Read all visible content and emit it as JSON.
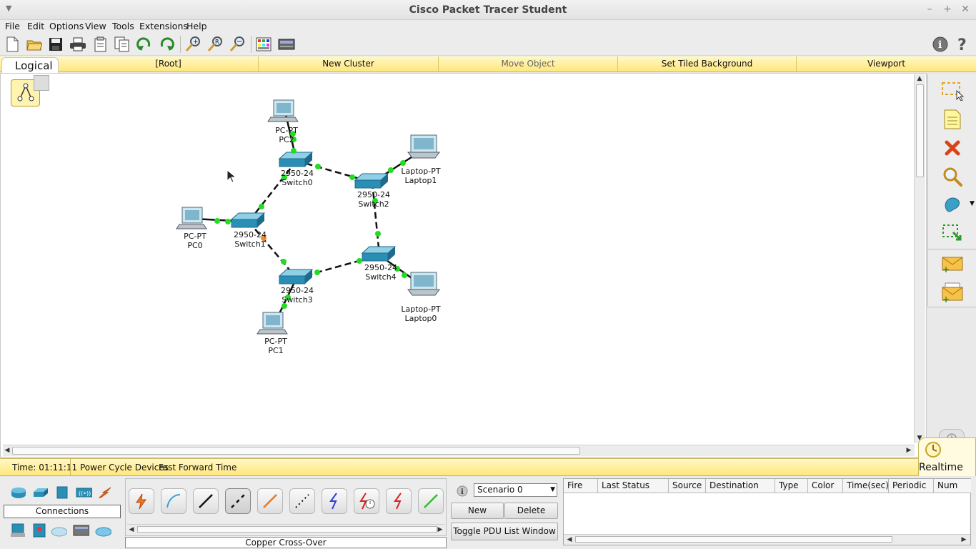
{
  "window": {
    "title": "Cisco Packet Tracer Student"
  },
  "menu": [
    "File",
    "Edit",
    "Options",
    "View",
    "Tools",
    "Extensions",
    "Help"
  ],
  "toolbar": {
    "icons": [
      "new-file-icon",
      "open-folder-icon",
      "save-icon",
      "print-icon",
      "activity-wizard-icon",
      "copy-icon",
      "undo-icon",
      "redo-icon",
      "zoom-in-icon",
      "zoom-reset-icon",
      "zoom-out-icon",
      "palette-icon",
      "custom-device-icon",
      "info-icon",
      "help-icon"
    ]
  },
  "logical_bar": {
    "tab": "Logical",
    "root": "[Root]",
    "new_cluster": "New Cluster",
    "move_object": "Move Object",
    "set_tiled_background": "Set Tiled Background",
    "viewport": "Viewport"
  },
  "topology": {
    "devices": [
      {
        "id": "pc2",
        "type": "PC-PT",
        "name": "PC2",
        "kind": "pc"
      },
      {
        "id": "switch0",
        "type": "2950-24",
        "name": "Switch0",
        "kind": "switch"
      },
      {
        "id": "switch2",
        "type": "2950-24",
        "name": "Switch2",
        "kind": "switch"
      },
      {
        "id": "laptop1",
        "type": "Laptop-PT",
        "name": "Laptop1",
        "kind": "laptop"
      },
      {
        "id": "pc0",
        "type": "PC-PT",
        "name": "PC0",
        "kind": "pc"
      },
      {
        "id": "switch1",
        "type": "2950-24",
        "name": "Switch1",
        "kind": "switch"
      },
      {
        "id": "switch4",
        "type": "2950-24",
        "name": "Switch4",
        "kind": "switch"
      },
      {
        "id": "switch3",
        "type": "2950-24",
        "name": "Switch3",
        "kind": "switch"
      },
      {
        "id": "laptop0",
        "type": "Laptop-PT",
        "name": "Laptop0",
        "kind": "laptop"
      },
      {
        "id": "pc1",
        "type": "PC-PT",
        "name": "PC1",
        "kind": "pc"
      }
    ],
    "links": [
      {
        "from": "pc2",
        "to": "switch0",
        "style": "solid",
        "status": "up"
      },
      {
        "from": "switch0",
        "to": "switch2",
        "style": "dashed",
        "status": "up"
      },
      {
        "from": "laptop1",
        "to": "switch2",
        "style": "solid",
        "status": "up"
      },
      {
        "from": "switch0",
        "to": "switch1",
        "style": "dashed",
        "status": "up"
      },
      {
        "from": "pc0",
        "to": "switch1",
        "style": "solid",
        "status": "up"
      },
      {
        "from": "switch2",
        "to": "switch4",
        "style": "dashed",
        "status": "up"
      },
      {
        "from": "switch1",
        "to": "switch3",
        "style": "dashed",
        "status": "orange-green"
      },
      {
        "from": "switch3",
        "to": "switch4",
        "style": "dashed",
        "status": "up"
      },
      {
        "from": "switch4",
        "to": "laptop0",
        "style": "solid",
        "status": "up"
      },
      {
        "from": "switch3",
        "to": "pc1",
        "style": "solid",
        "status": "up"
      }
    ]
  },
  "right_palette": [
    "select-icon",
    "note-icon",
    "delete-icon",
    "inspect-icon",
    "draw-shape-icon",
    "resize-icon",
    "add-simple-pdu-icon",
    "add-complex-pdu-icon"
  ],
  "timebar": {
    "time": "Time: 01:11:11",
    "power_cycle": "Power Cycle Devices",
    "fast_forward": "Fast Forward Time",
    "mode": "Realtime"
  },
  "device_panel": {
    "category_label": "Connections",
    "subtype_label": "Copper Cross-Over"
  },
  "connections": [
    {
      "name": "automatic-connection-icon",
      "color": "#e87722"
    },
    {
      "name": "console-cable-icon",
      "color": "#3aa0d8"
    },
    {
      "name": "copper-straight-through-icon",
      "color": "#111111"
    },
    {
      "name": "copper-cross-over-icon",
      "color": "#111111"
    },
    {
      "name": "fiber-icon",
      "color": "#e87722"
    },
    {
      "name": "phone-cable-icon",
      "color": "#111111"
    },
    {
      "name": "coaxial-icon",
      "color": "#2d3fd6"
    },
    {
      "name": "serial-dce-icon",
      "color": "#d92020"
    },
    {
      "name": "serial-dte-icon",
      "color": "#d92020"
    },
    {
      "name": "octal-cable-icon",
      "color": "#2fbf2f"
    }
  ],
  "scenario": {
    "selected": "Scenario 0",
    "new_label": "New",
    "delete_label": "Delete",
    "toggle_label": "Toggle PDU List Window"
  },
  "pdu_table": {
    "columns": [
      "Fire",
      "Last Status",
      "Source",
      "Destination",
      "Type",
      "Color",
      "Time(sec)",
      "Periodic",
      "Num"
    ]
  },
  "colors": {
    "link_up": "#22dd22",
    "link_orange": "#f08a30",
    "strip_yellow": "#ffe77c"
  }
}
